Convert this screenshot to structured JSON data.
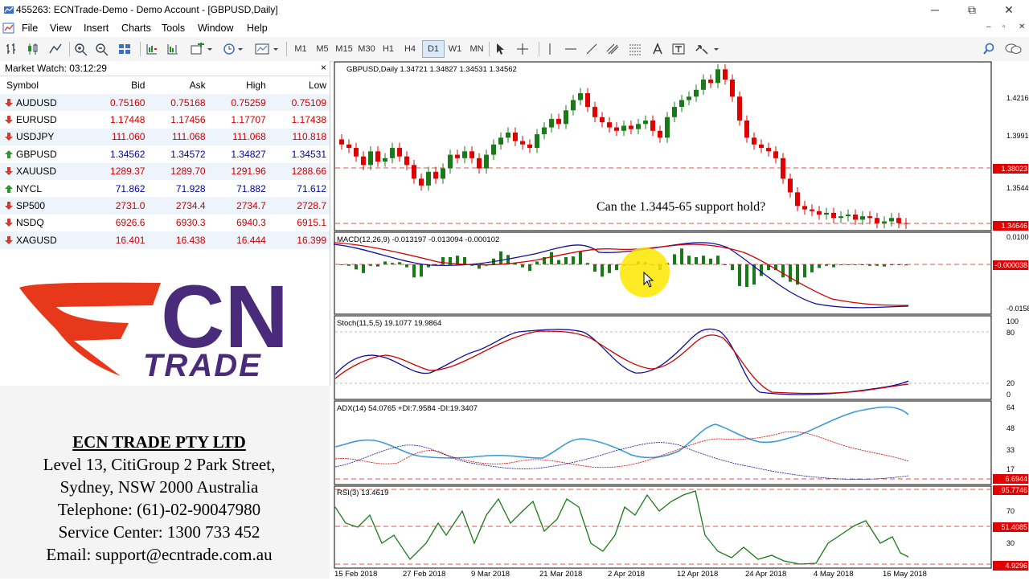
{
  "window": {
    "title": "455263: ECNTrade-Demo - Demo Account - [GBPUSD,Daily]",
    "minimize": "─",
    "restore": "⧉",
    "close": "✕"
  },
  "menu": {
    "items": [
      "File",
      "View",
      "Insert",
      "Charts",
      "Tools",
      "Window",
      "Help"
    ],
    "mdi_min": "–",
    "mdi_restore": "▫",
    "mdi_close": "✕"
  },
  "toolbar": {
    "timeframes": [
      "M1",
      "M5",
      "M15",
      "M30",
      "H1",
      "H4",
      "D1",
      "W1",
      "MN"
    ],
    "active_timeframe": "D1"
  },
  "market_watch": {
    "title": "Market Watch: 03:12:29",
    "close": "×",
    "columns": [
      "Symbol",
      "Bid",
      "Ask",
      "High",
      "Low"
    ],
    "rows": [
      {
        "symbol": "AUDUSD",
        "bid": "0.75160",
        "ask": "0.75168",
        "high": "0.75259",
        "low": "0.75109",
        "dir": "down"
      },
      {
        "symbol": "EURUSD",
        "bid": "1.17448",
        "ask": "1.17456",
        "high": "1.17707",
        "low": "1.17438",
        "dir": "down"
      },
      {
        "symbol": "USDJPY",
        "bid": "111.060",
        "ask": "111.068",
        "high": "111.068",
        "low": "110.818",
        "dir": "down"
      },
      {
        "symbol": "GBPUSD",
        "bid": "1.34562",
        "ask": "1.34572",
        "high": "1.34827",
        "low": "1.34531",
        "dir": "up"
      },
      {
        "symbol": "XAUUSD",
        "bid": "1289.37",
        "ask": "1289.70",
        "high": "1291.96",
        "low": "1288.66",
        "dir": "down"
      },
      {
        "symbol": "NYCL",
        "bid": "71.862",
        "ask": "71.928",
        "high": "71.882",
        "low": "71.612",
        "dir": "up"
      },
      {
        "symbol": "SP500",
        "bid": "2731.0",
        "ask": "2734.4",
        "high": "2734.7",
        "low": "2728.7",
        "dir": "down"
      },
      {
        "symbol": "NSDQ",
        "bid": "6926.6",
        "ask": "6930.3",
        "high": "6940.3",
        "low": "6915.1",
        "dir": "down"
      },
      {
        "symbol": "XAGUSD",
        "bid": "16.401",
        "ask": "16.438",
        "high": "16.444",
        "low": "16.399",
        "dir": "down"
      }
    ]
  },
  "logo": {
    "line1": "CN",
    "line2": "TRADE"
  },
  "company": {
    "name": "ECN TRADE PTY LTD",
    "address1": "Level 13, CitiGroup 2 Park Street,",
    "address2": "Sydney, NSW 2000 Australia",
    "phone": "Telephone: (61)-02-90047980",
    "service": "Service Center: 1300 733 452",
    "email": "Email: support@ecntrade.com.au"
  },
  "colors": {
    "bull": "#1a7a1a",
    "bear": "#e00000",
    "macd_line": "#1010a0",
    "signal_line": "#d00000",
    "adx_line": "#3a9ad9",
    "badge": "#e30000",
    "highlight": "#a9dbe6",
    "brand_red": "#e8381c",
    "brand_purple": "#4a2a7a"
  },
  "chart": {
    "header": "GBPUSD,Daily  1.34721 1.34827 1.34531 1.34562",
    "annotation": "Can the 1.3445-65 support hold?",
    "price_axis": [
      "1.42160",
      "1.39910",
      "1.35440"
    ],
    "price_badges": [
      "1.38023",
      "1.34646"
    ],
    "macd_label": "MACD(12,26,9) -0.013197 -0.013094 -0.000102",
    "macd_axis": [
      "0.010007",
      "-0.015883"
    ],
    "macd_badge": "-0.000038",
    "stoch_label": "Stoch(11,5,5) 19.1077 19.9864",
    "stoch_axis": [
      "100",
      "80",
      "20",
      "0"
    ],
    "adx_label": "ADX(14) 54.0765 +DI:7.9584 -DI:19.3407",
    "adx_axis": [
      "64",
      "48",
      "33",
      "17"
    ],
    "adx_badge": "6.6944",
    "rsi_label": "RSI(3) 13.4619",
    "rsi_axis": [
      "70",
      "30"
    ],
    "rsi_badges": [
      "95.7746",
      "51.4085",
      "4.9296"
    ],
    "dates": [
      "15 Feb 2018",
      "27 Feb 2018",
      "9 Mar 2018",
      "21 Mar 2018",
      "2 Apr 2018",
      "12 Apr 2018",
      "24 Apr 2018",
      "4 May 2018",
      "16 May 2018"
    ]
  },
  "chart_data": {
    "type": "candlestick",
    "symbol": "GBPUSD",
    "timeframe": "Daily",
    "close_series": [
      1.392,
      1.39,
      1.385,
      1.38,
      1.388,
      1.382,
      1.384,
      1.39,
      1.385,
      1.38,
      1.372,
      1.368,
      1.376,
      1.372,
      1.378,
      1.386,
      1.384,
      1.388,
      1.384,
      1.378,
      1.386,
      1.392,
      1.396,
      1.399,
      1.394,
      1.392,
      1.39,
      1.398,
      1.402,
      1.407,
      1.404,
      1.412,
      1.418,
      1.422,
      1.414,
      1.408,
      1.405,
      1.402,
      1.4,
      1.403,
      1.401,
      1.404,
      1.406,
      1.4,
      1.396,
      1.408,
      1.414,
      1.418,
      1.42,
      1.424,
      1.43,
      1.428,
      1.436,
      1.43,
      1.42,
      1.406,
      1.396,
      1.392,
      1.39,
      1.388,
      1.384,
      1.372,
      1.364,
      1.356,
      1.354,
      1.353,
      1.351,
      1.352,
      1.349,
      1.35,
      1.351,
      1.348,
      1.35,
      1.349,
      1.346,
      1.347,
      1.349,
      1.346,
      1.3456
    ],
    "horizontal_levels": [
      1.38023,
      1.34646
    ],
    "ylim": [
      1.343,
      1.438
    ]
  }
}
